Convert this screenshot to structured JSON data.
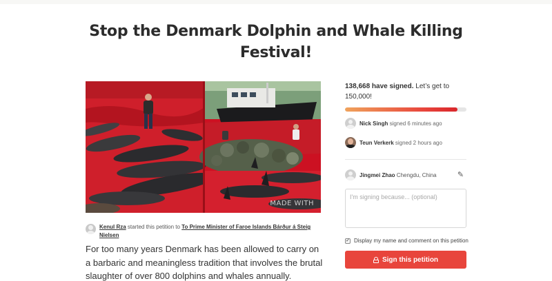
{
  "petition": {
    "title": "Stop the Denmark Dolphin and Whale Killing Festival!",
    "image_watermark": "MADE WITH",
    "starter": {
      "name": "Kenul Rza",
      "action": " started this petition to ",
      "target": "To Prime Minister of Faroe Islands Bárður á Steig Nielsen"
    },
    "description": "For too many years Denmark has been allowed to carry on a barbaric and meaningless tradition that involves the brutal slaughter of over 800 dolphins and whales annually."
  },
  "sidebar": {
    "signed_count": "138,668 have signed.",
    "goal_text": " Let’s get to 150,000!",
    "progress_fraction": 0.924,
    "recent_signers": [
      {
        "name": "Nick Singh",
        "action": " signed 6 minutes ago",
        "avatar": "default-avatar"
      },
      {
        "name": "Teun Verkerk",
        "action": " signed 2 hours ago",
        "avatar": "photo-avatar"
      }
    ],
    "current_user": {
      "name": "Jingmei Zhao",
      "location": "Chengdu, China",
      "edit_icon": "pencil-icon"
    },
    "reason_placeholder": "I'm signing because... (optional)",
    "display_checkbox_label": "Display my name and comment on this petition",
    "display_checkbox_checked": true,
    "sign_button_label": "Sign this petition",
    "sign_button_icon": "lock-icon"
  },
  "colors": {
    "accent": "#e8453c",
    "progress_start": "#f0a35c",
    "progress_end": "#d9262b"
  }
}
